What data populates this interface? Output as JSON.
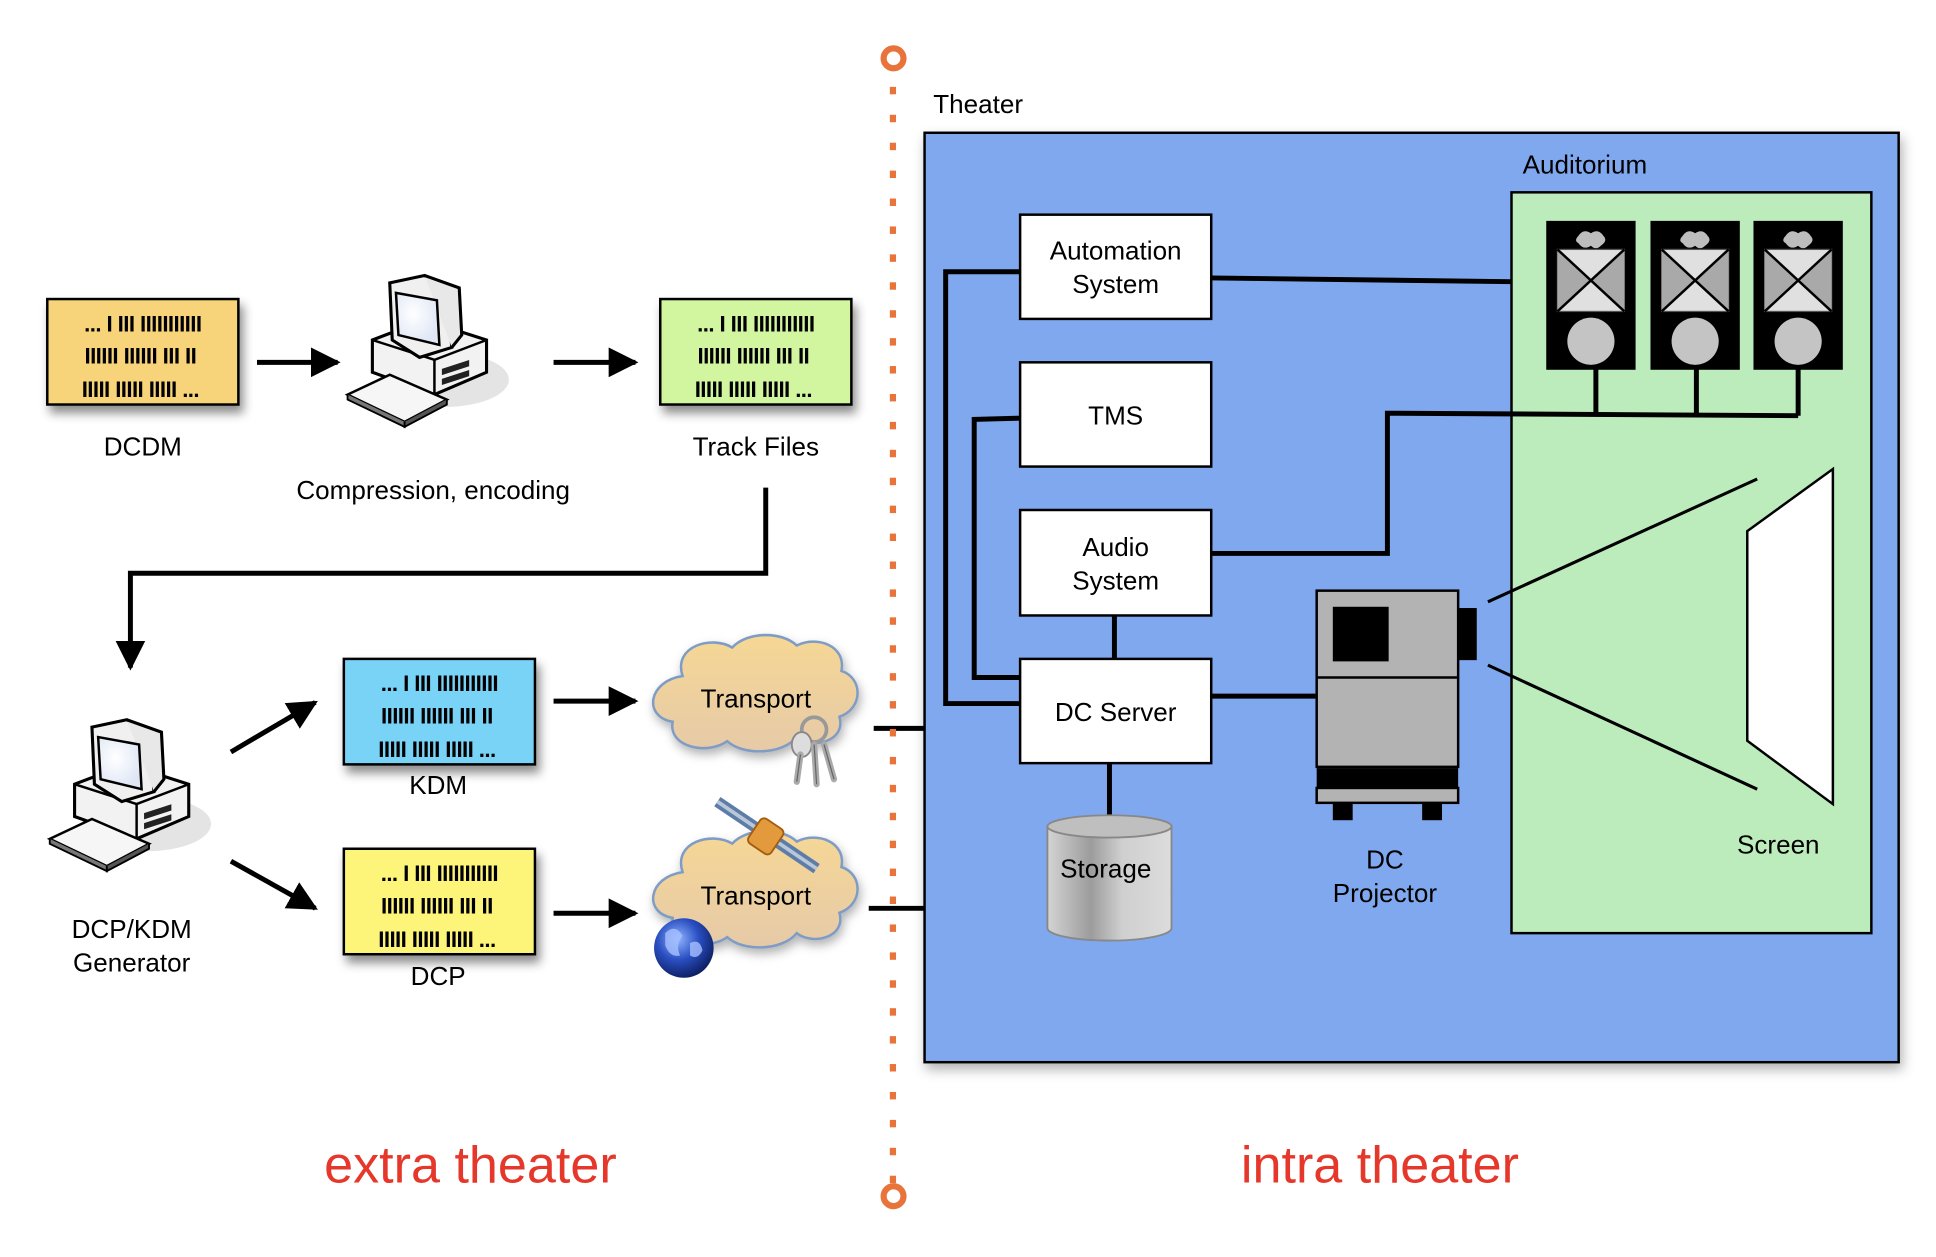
{
  "extra_theater": {
    "heading": "extra theater",
    "files": [
      {
        "id": "dcdm",
        "label": "DCDM",
        "color": "#f7d37a",
        "lines": [
          "... I III IIIIIIIIIII",
          "IIIIII IIIIII III II",
          "IIIII IIIII IIIII ..."
        ]
      },
      {
        "id": "track-files",
        "label": "Track Files",
        "color": "#d2f5a0",
        "lines": [
          "... I III IIIIIIIIIII",
          "IIIIII IIIIII III II",
          "IIIII IIIII IIIII ..."
        ]
      },
      {
        "id": "kdm",
        "label": "KDM",
        "color": "#79d3f7",
        "lines": [
          "... I III IIIIIIIIIII",
          "IIIIII IIIIII III II",
          "IIIII IIIII IIIII ..."
        ]
      },
      {
        "id": "dcp",
        "label": "DCP",
        "color": "#fdf47a",
        "lines": [
          "... I III IIIIIIIIIII",
          "IIIIII IIIIII III II",
          "IIIII IIIII IIIII ..."
        ]
      }
    ],
    "computers": [
      {
        "id": "compression",
        "label": "Compression, encoding"
      },
      {
        "id": "generator",
        "label_lines": [
          "DCP/KDM",
          "Generator"
        ]
      }
    ],
    "transports": [
      {
        "id": "transport-keys",
        "label": "Transport",
        "badge": "keys-icon"
      },
      {
        "id": "transport-satellite",
        "label": "Transport",
        "badge": "satellite-globe-icon"
      }
    ]
  },
  "divider": {
    "color": "#e8743b"
  },
  "intra_theater": {
    "heading": "intra theater",
    "theater_label": "Theater",
    "theater_color": "#80a8ee",
    "auditorium_label": "Auditorium",
    "auditorium_color": "#bdecbc",
    "systems": [
      {
        "id": "automation",
        "lines": [
          "Automation",
          "System"
        ]
      },
      {
        "id": "tms",
        "lines": [
          "TMS"
        ]
      },
      {
        "id": "audio",
        "lines": [
          "Audio",
          "System"
        ]
      },
      {
        "id": "dc-server",
        "lines": [
          "DC Server"
        ]
      }
    ],
    "storage_label": "Storage",
    "projector_lines": [
      "DC",
      "Projector"
    ],
    "screen_label": "Screen",
    "speaker_count": 3
  },
  "colors": {
    "heading": "#e5382b"
  }
}
